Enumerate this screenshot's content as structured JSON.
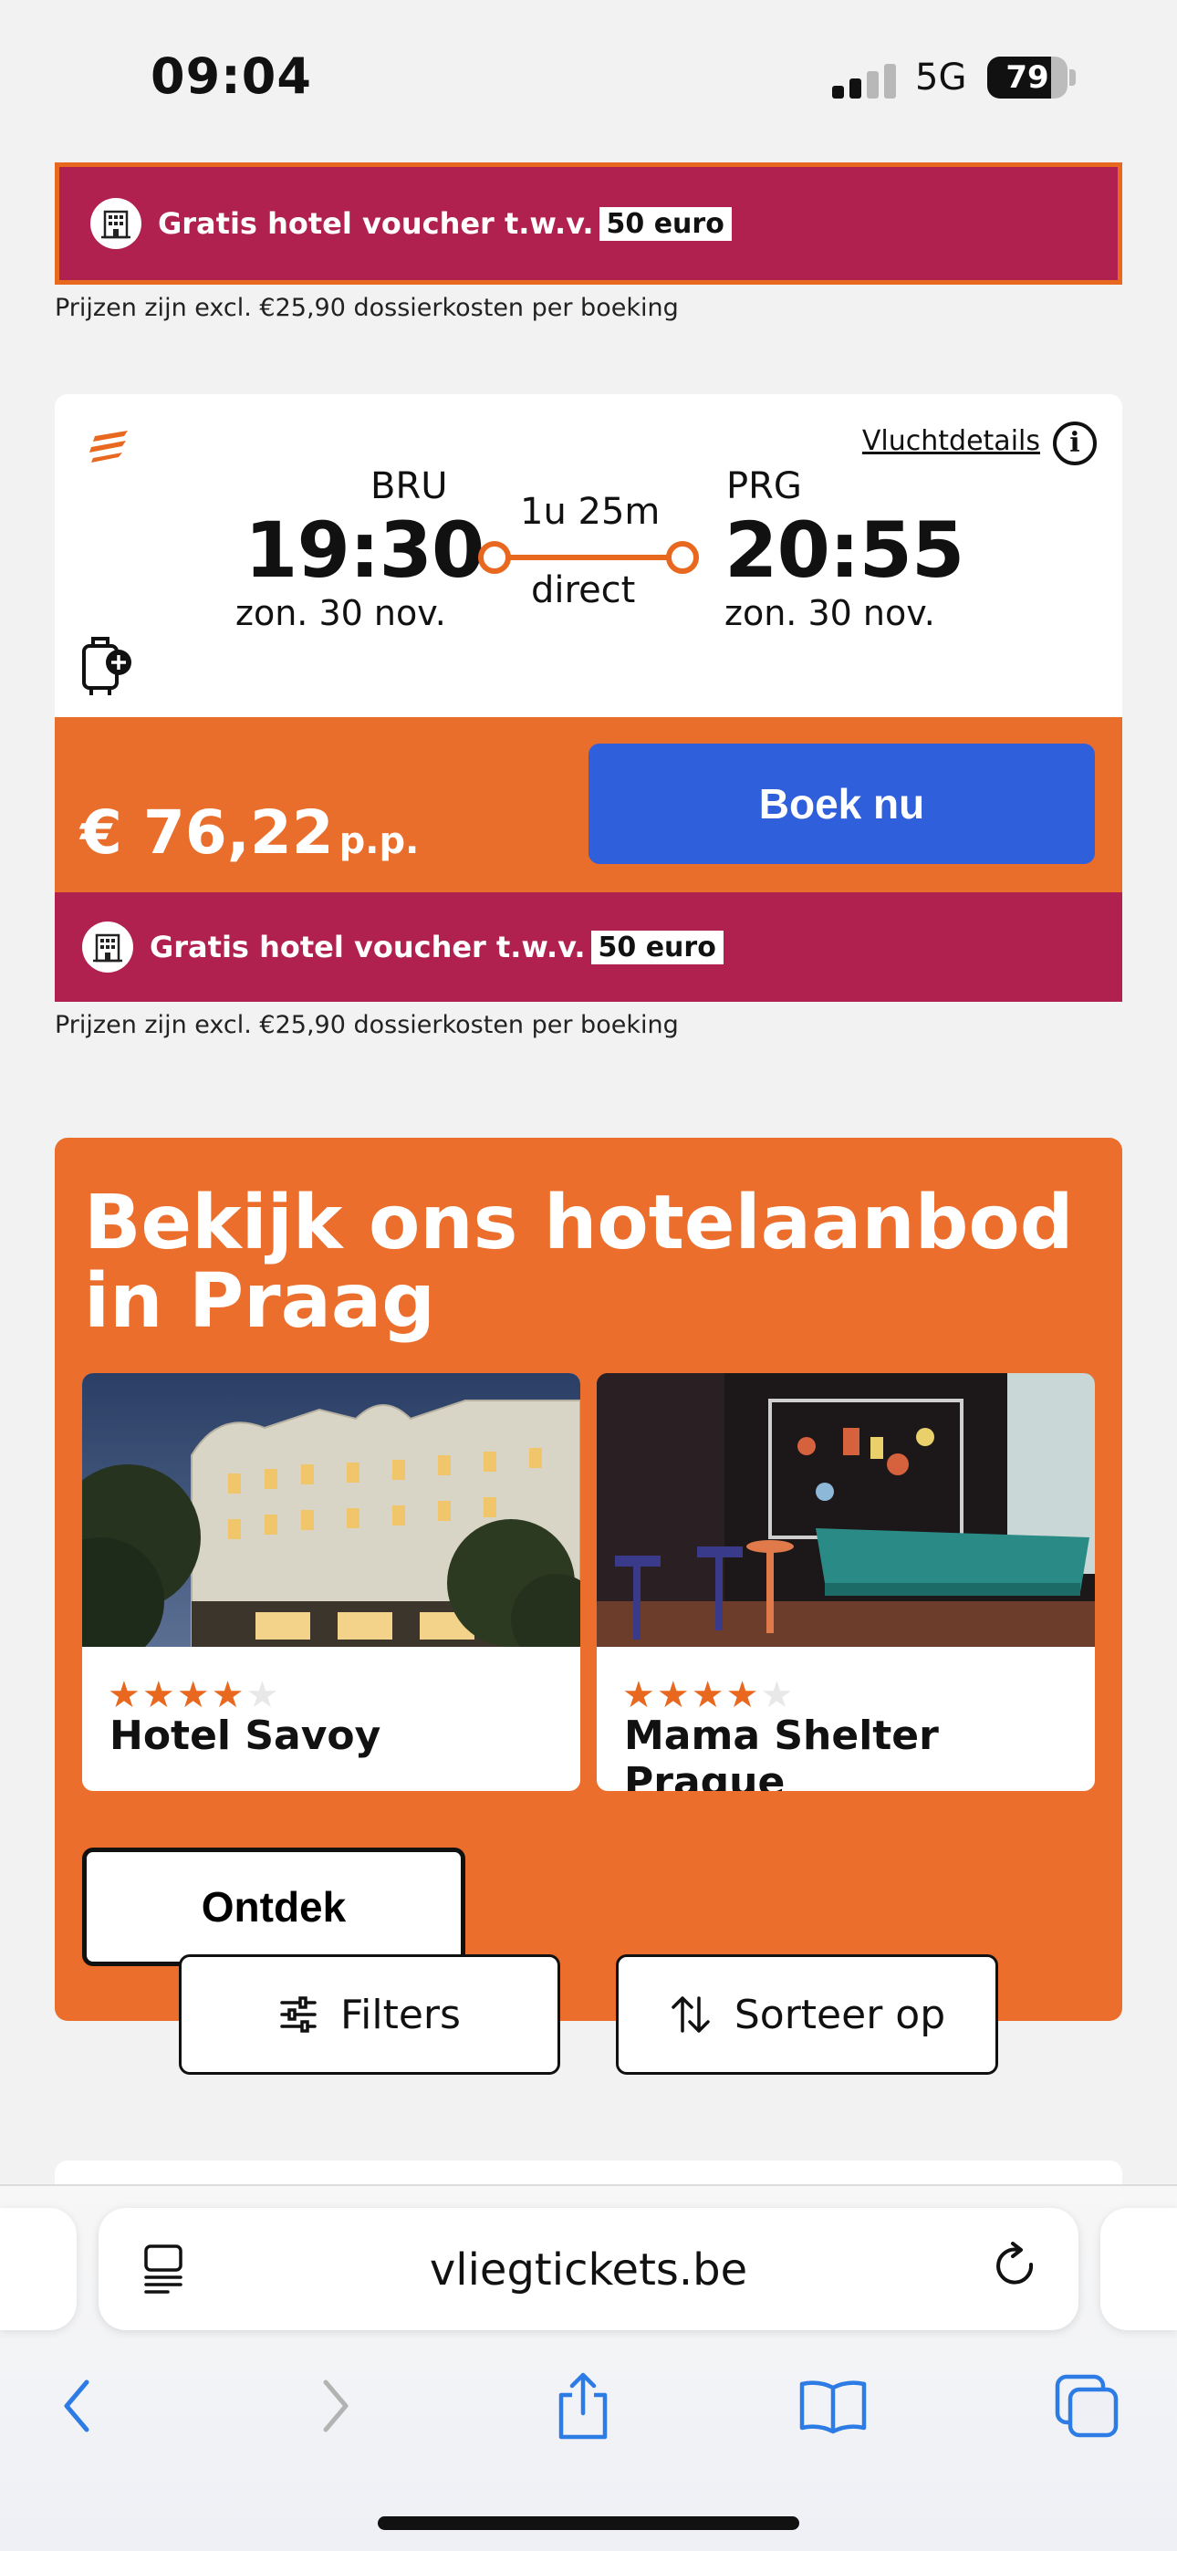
{
  "status_bar": {
    "time": "09:04",
    "network": "5G",
    "battery": "79",
    "battery_level": 0.79
  },
  "voucher": {
    "text": "Gratis hotel voucher t.w.v.",
    "amount": "50 euro"
  },
  "fineprint": "Prijzen zijn excl. €25,90 dossierkosten per boeking",
  "flight": {
    "details_link": "Vluchtdetails",
    "origin_code": "BRU",
    "departure_time": "19:30",
    "departure_date": "zon. 30 nov.",
    "duration": "1u 25m",
    "stops": "direct",
    "dest_code": "PRG",
    "arrival_time": "20:55",
    "arrival_date": "zon. 30 nov.",
    "price": "€ 76,22",
    "price_unit": "p.p.",
    "book_label": "Boek nu"
  },
  "hotels": {
    "title": "Bekijk ons hotelaanbod in Praag",
    "items": [
      {
        "name": "Hotel Savoy",
        "stars": 4,
        "max_stars": 5
      },
      {
        "name": "Mama Shelter Prague",
        "stars": 4,
        "max_stars": 5
      }
    ],
    "cta": "Ontdek"
  },
  "toolbar": {
    "filters_label": "Filters",
    "sort_label": "Sorteer op"
  },
  "browser": {
    "url": "vliegtickets.be"
  },
  "colors": {
    "orange": "#e96d2b",
    "magenta": "#b0214f",
    "blue": "#2f5fdb",
    "ios_blue": "#2d7be5"
  }
}
